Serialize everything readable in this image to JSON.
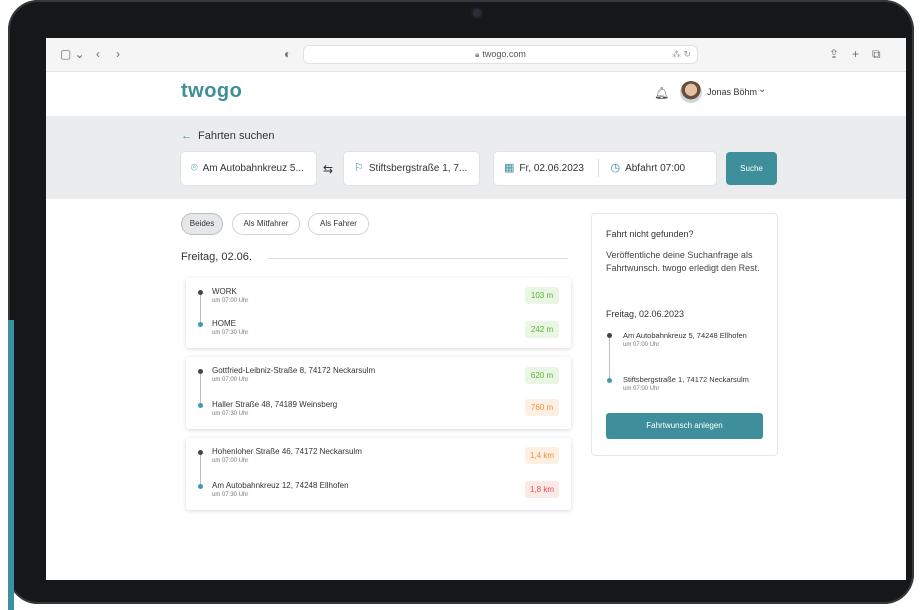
{
  "browser": {
    "url": "twogo.com",
    "icons": {
      "sidebar": "sidebar-icon",
      "back": "back-arrow-icon",
      "forward": "forward-arrow-icon",
      "shield": "shield-icon",
      "lock": "lock-icon",
      "translate": "translate-icon",
      "reload": "reload-icon",
      "share": "share-icon",
      "new_tab": "plus-icon",
      "tabs": "tabs-icon"
    }
  },
  "header": {
    "logo": "twogo",
    "user_name": "Jonas Böhm"
  },
  "search": {
    "back_label": "Fahrten suchen",
    "from": "Am Autobahnkreuz 5...",
    "to": "Stiftsbergstraße 1, 7...",
    "date": "Fr, 02.06.2023",
    "time": "Abfahrt 07:00",
    "button": "Suche"
  },
  "filters": {
    "options": [
      "Beides",
      "Als Mitfahrer",
      "Als Fahrer"
    ],
    "active": "Beides"
  },
  "day_header": "Freitag, 02.06.",
  "rides": [
    {
      "from": "WORK",
      "from_time": "um 07:00 Uhr",
      "from_dist": "103 m",
      "to": "HOME",
      "to_time": "um 07:30 Uhr",
      "to_dist": "242 m"
    },
    {
      "from": "Gottfried-Leibniz-Straße 8, 74172 Neckarsulm",
      "from_time": "um 07:00 Uhr",
      "from_dist": "620 m",
      "to": "Haller Straße 48, 74189 Weinsberg",
      "to_time": "um 07:30 Uhr",
      "to_dist": "760 m"
    },
    {
      "from": "Hohenloher Straße 46, 74172 Neckarsulm",
      "from_time": "um 07:00 Uhr",
      "from_dist": "1,4 km",
      "to": "Am Autobahnkreuz 12, 74248 Ellhofen",
      "to_time": "um 07:30 Uhr",
      "to_dist": "1,8 km"
    }
  ],
  "sidebar": {
    "title": "Fahrt nicht gefunden?",
    "text": "Veröffentliche deine Suchanfrage als Fahrtwunsch. twogo erledigt den Rest.",
    "date": "Freitag, 02.06.2023",
    "from": "Am Autobahnkreuz 5, 74248 Ellhofen",
    "from_time": "um 07:00 Uhr",
    "to": "Stiftsbergstraße 1, 74172 Neckarsulm",
    "to_time": "um 07:00 Uhr",
    "button": "Fahrtwunsch anlegen"
  },
  "colors": {
    "brand": "#3e8e9b",
    "dist_green_bg": "#eaf6e4",
    "dist_green_fg": "#5fae3a",
    "dist_orange_bg": "#fdf0e2",
    "dist_orange_fg": "#e8913a",
    "dist_red_bg": "#fde8e8",
    "dist_red_fg": "#e05353"
  }
}
